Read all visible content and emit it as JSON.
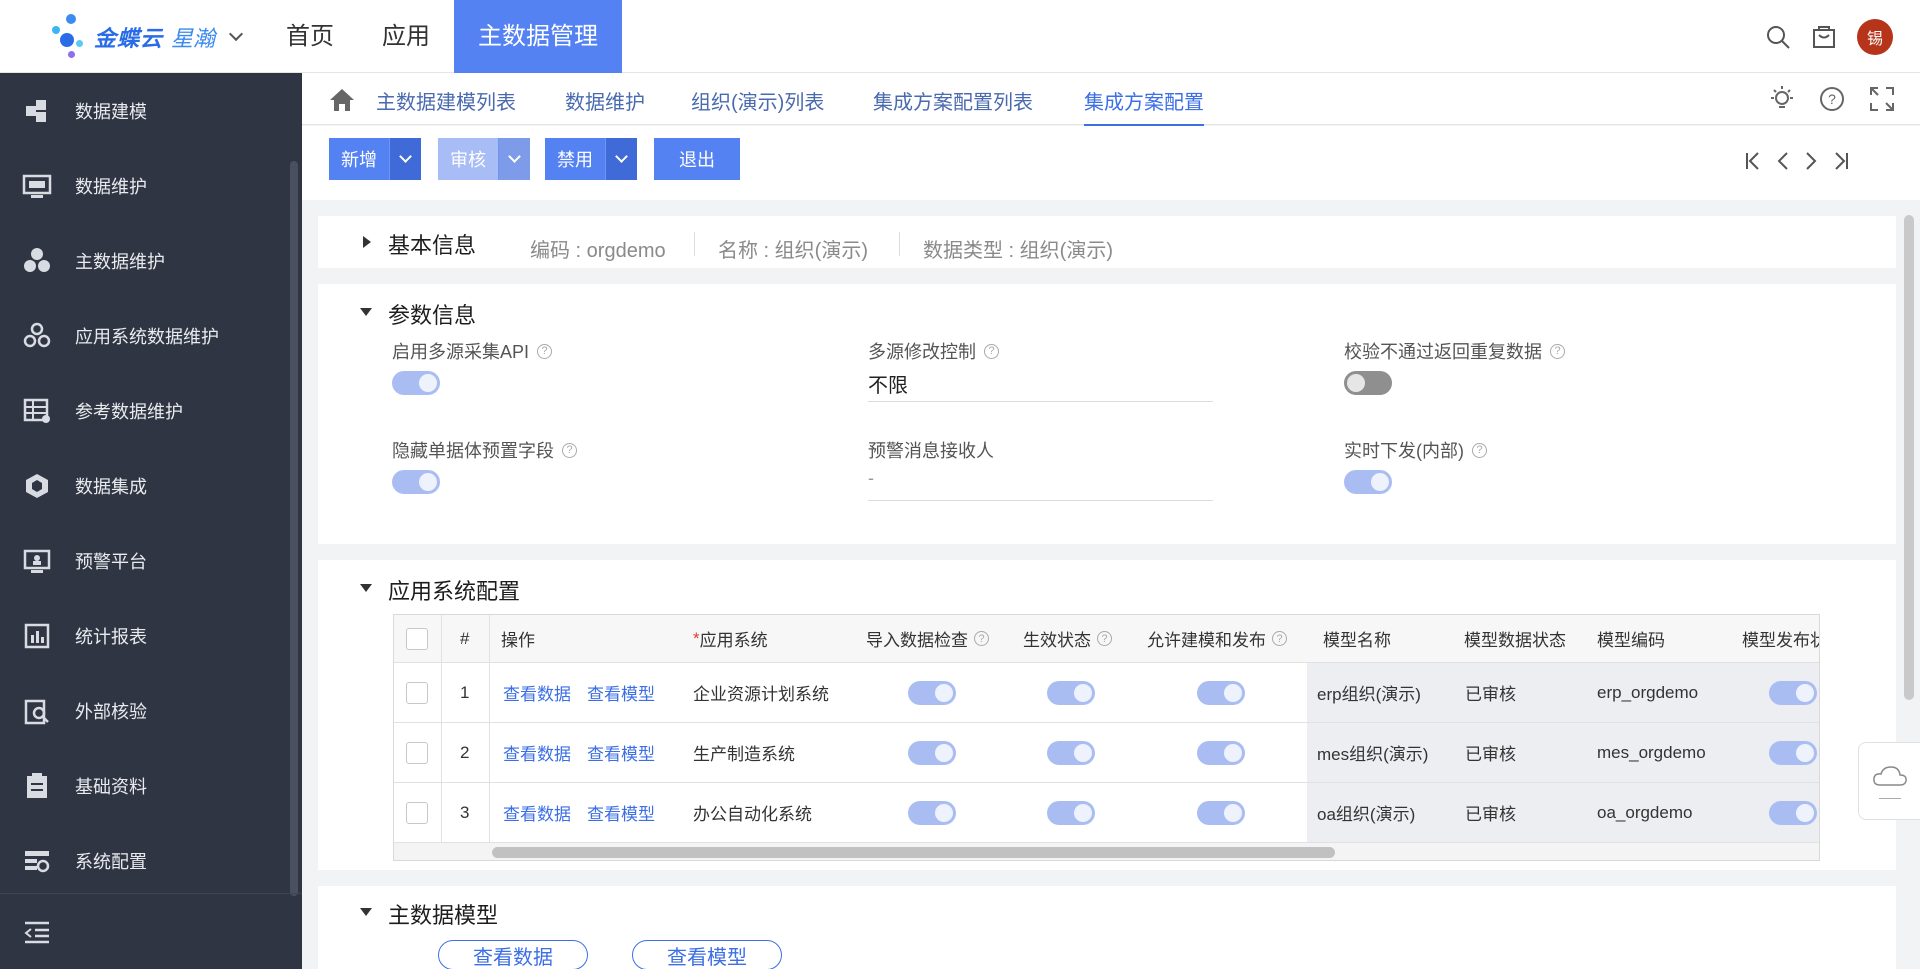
{
  "header": {
    "logo_text": "金蝶云",
    "logo_text2": "星瀚",
    "nav": [
      "首页",
      "应用",
      "主数据管理"
    ],
    "active_nav": "主数据管理",
    "avatar_text": "锡"
  },
  "sidebar": {
    "items": [
      "数据建模",
      "数据维护",
      "主数据维护",
      "应用系统数据维护",
      "参考数据维护",
      "数据集成",
      "预警平台",
      "统计报表",
      "外部核验",
      "基础资料",
      "系统配置"
    ]
  },
  "tabs": [
    "主数据建模列表",
    "数据维护",
    "组织(演示)列表",
    "集成方案配置列表",
    "集成方案配置"
  ],
  "active_tab": "集成方案配置",
  "toolbar": {
    "new_label": "新增",
    "audit_label": "审核",
    "disable_label": "禁用",
    "exit_label": "退出"
  },
  "basic_info": {
    "title": "基本信息",
    "code": "编码 : orgdemo",
    "name": "名称 : 组织(演示)",
    "data_type": "数据类型 : 组织(演示)"
  },
  "params": {
    "title": "参数信息",
    "enable_api_label": "启用多源采集API",
    "enable_api": true,
    "multi_source_label": "多源修改控制",
    "multi_source_value": "不限",
    "verify_fail_label": "校验不通过返回重复数据",
    "verify_fail": false,
    "hide_preset_label": "隐藏单据体预置字段",
    "hide_preset": true,
    "alert_receiver_label": "预警消息接收人",
    "alert_receiver_value": "-",
    "realtime_label": "实时下发(内部)",
    "realtime": true
  },
  "app_config": {
    "title": "应用系统配置",
    "columns": {
      "index": "#",
      "op": "操作",
      "req_mark": "*",
      "app": "应用系统",
      "import_check": "导入数据检查",
      "effective": "生效状态",
      "allow_model": "允许建模和发布",
      "model_name": "模型名称",
      "model_status": "模型数据状态",
      "model_code": "模型编码",
      "model_publish": "模型发布状"
    },
    "view_data": "查看数据",
    "view_model": "查看模型",
    "rows": [
      {
        "index": "1",
        "app": "企业资源计划系统",
        "import_check": true,
        "effective": true,
        "allow_model": true,
        "model_name": "erp组织(演示)",
        "model_status": "已审核",
        "model_code": "erp_orgdemo",
        "model_publish": true
      },
      {
        "index": "2",
        "app": "生产制造系统",
        "import_check": true,
        "effective": true,
        "allow_model": true,
        "model_name": "mes组织(演示)",
        "model_status": "已审核",
        "model_code": "mes_orgdemo",
        "model_publish": true
      },
      {
        "index": "3",
        "app": "办公自动化系统",
        "import_check": true,
        "effective": true,
        "allow_model": true,
        "model_name": "oa组织(演示)",
        "model_status": "已审核",
        "model_code": "oa_orgdemo",
        "model_publish": true
      }
    ]
  },
  "master_model": {
    "title": "主数据模型",
    "view_data": "查看数据",
    "view_model": "查看模型"
  },
  "colors": {
    "accent": "#5582f3",
    "sidebar_bg": "#2f3542",
    "link": "#3c6fe6",
    "toggle_on": "#a9bdf2"
  }
}
